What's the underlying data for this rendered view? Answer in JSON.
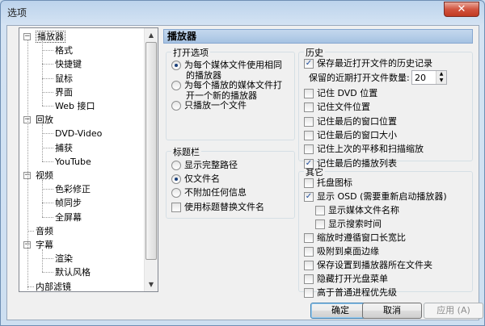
{
  "window": {
    "title": "选项",
    "close_glyph": "✕"
  },
  "tree": {
    "items": [
      {
        "label": "播放器",
        "level": 1,
        "expander": "⊟",
        "selected": true
      },
      {
        "label": "格式",
        "level": 2
      },
      {
        "label": "快捷键",
        "level": 2
      },
      {
        "label": "鼠标",
        "level": 2
      },
      {
        "label": "界面",
        "level": 2
      },
      {
        "label": "Web 接口",
        "level": 2
      },
      {
        "label": "回放",
        "level": 1,
        "expander": "⊟"
      },
      {
        "label": "DVD-Video",
        "level": 2
      },
      {
        "label": "捕获",
        "level": 2
      },
      {
        "label": "YouTube",
        "level": 2
      },
      {
        "label": "视频",
        "level": 1,
        "expander": "⊟"
      },
      {
        "label": "色彩修正",
        "level": 2
      },
      {
        "label": "帧同步",
        "level": 2
      },
      {
        "label": "全屏幕",
        "level": 2
      },
      {
        "label": "音频",
        "level": 1
      },
      {
        "label": "字幕",
        "level": 1,
        "expander": "⊟"
      },
      {
        "label": "渲染",
        "level": 2
      },
      {
        "label": "默认风格",
        "level": 2
      },
      {
        "label": "内部滤镜",
        "level": 1
      }
    ],
    "scroll_up": "▲",
    "scroll_down": "▼"
  },
  "panel": {
    "header": "播放器"
  },
  "open_options": {
    "title": "打开选项",
    "options": [
      {
        "label_line1": "为每个媒体文件使用相同",
        "label_line2": "的播放器",
        "selected": true
      },
      {
        "label_line1": "为每个播放的媒体文件打",
        "label_line2": "开一个新的播放器",
        "selected": false
      },
      {
        "label_line1": "只播放一个文件",
        "label_line2": "",
        "selected": false
      }
    ]
  },
  "titlebar_group": {
    "title": "标题栏",
    "options": [
      {
        "label": "显示完整路径",
        "selected": false
      },
      {
        "label": "仅文件名",
        "selected": true
      },
      {
        "label": "不附加任何信息",
        "selected": false
      }
    ],
    "checkbox": {
      "label": "使用标题替换文件名",
      "checked": false
    }
  },
  "history": {
    "title": "历史",
    "save_history": {
      "label": "保存最近打开文件的历史记录",
      "checked": true
    },
    "recent_count_label": "保留的近期打开文件数量:",
    "recent_count_value": "20",
    "items": [
      {
        "label": "记住 DVD 位置",
        "checked": false
      },
      {
        "label": "记住文件位置",
        "checked": false
      },
      {
        "label": "记住最后的窗口位置",
        "checked": false
      },
      {
        "label": "记住最后的窗口大小",
        "checked": false
      },
      {
        "label": "记住上次的平移和扫描缩放",
        "checked": false
      },
      {
        "label": "记住最后的播放列表",
        "checked": true
      }
    ]
  },
  "other": {
    "title": "其它",
    "items": [
      {
        "label": "托盘图标",
        "checked": false,
        "indent": 0
      },
      {
        "label": "显示 OSD (需要重新启动播放器)",
        "checked": true,
        "indent": 0
      },
      {
        "label": "显示媒体文件名称",
        "checked": false,
        "indent": 1
      },
      {
        "label": "显示搜索时间",
        "checked": false,
        "indent": 1
      },
      {
        "label": "缩放时遵循窗口长宽比",
        "checked": false,
        "indent": 0
      },
      {
        "label": "吸附到桌面边缘",
        "checked": false,
        "indent": 0
      },
      {
        "label": "保存设置到播放器所在文件夹",
        "checked": false,
        "indent": 0
      },
      {
        "label": "隐藏打开光盘菜单",
        "checked": false,
        "indent": 0
      },
      {
        "label": "高于普通进程优先级",
        "checked": false,
        "indent": 0
      }
    ]
  },
  "buttons": {
    "ok": "确定",
    "cancel": "取消",
    "apply": "应用 (A)"
  },
  "check_glyph": "✓"
}
